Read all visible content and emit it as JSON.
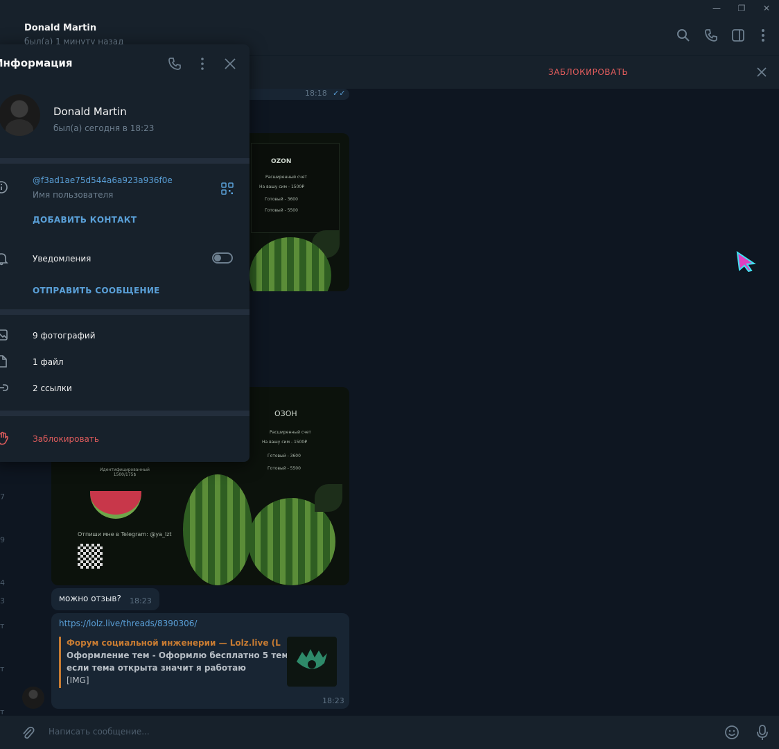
{
  "window": {
    "minimize": "—",
    "restore": "❐",
    "close": "✕"
  },
  "header": {
    "name": "Donald Martin",
    "status": "был(а) 1 минуту назад"
  },
  "block_bar": {
    "label": "ЗАБЛОКИРОВАТЬ"
  },
  "chat": {
    "top_time": "18:18",
    "image1": {
      "title": "OZON",
      "lines": [
        "Расширенный счет",
        "На вашу сим - 1500₽",
        "Готовый - 3600",
        "Готовый - 5500"
      ]
    },
    "image2": {
      "title": "ОЗОН",
      "lines": [
        "Расширенный счет",
        "На вашу сим - 1500₽",
        "Готовый - 3600",
        "Готовый - 5500"
      ],
      "left_caption": "Идентифицированный 1500/175$",
      "contact": "Отпиши мне в Telegram: @ya_lzt"
    },
    "msg_question": "можно отзыв?",
    "msg_question_time": "18:23",
    "link_url": "https://lolz.live/threads/8390306/",
    "preview_title": "Форум социальной инженерии — Lolz.live (L...",
    "preview_lines": [
      "Оформление тем - Оформлю бесплатно 5 тем,",
      "если тема открыта значит я работаю",
      "[IMG]"
    ],
    "link_time": "18:23"
  },
  "side_numbers": [
    "7",
    "9",
    "4",
    "3",
    "т",
    "т",
    "т"
  ],
  "composer": {
    "placeholder": "Написать сообщение..."
  },
  "info": {
    "title": "Информация",
    "name": "Donald Martin",
    "status": "был(а) сегодня в 18:23",
    "username": "@f3ad1ae75d544a6a923a936f0e",
    "username_label": "Имя пользователя",
    "add_contact": "ДОБАВИТЬ КОНТАКТ",
    "notifications": "Уведомления",
    "send_message": "ОТПРАВИТЬ СООБЩЕНИЕ",
    "photos": "9 фотографий",
    "files": "1 файл",
    "links": "2 ссылки",
    "block": "Заблокировать"
  },
  "colors": {
    "bg": "#0e1621",
    "panel": "#17212b",
    "accent": "#5aa0d8",
    "danger": "#e05c5c",
    "link_preview": "#c77b32"
  }
}
